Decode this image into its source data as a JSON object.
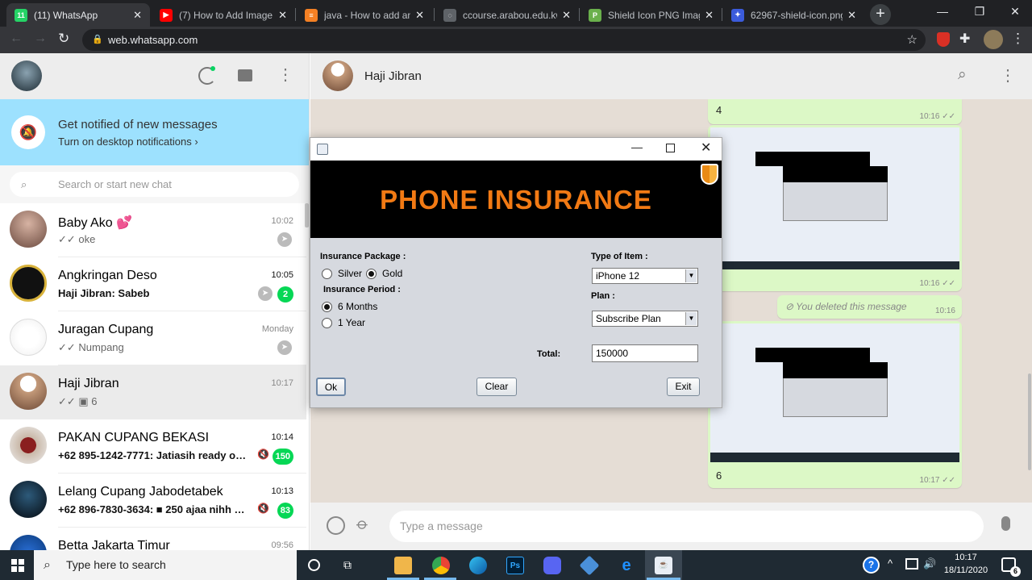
{
  "browser": {
    "tabs": [
      {
        "title": "(11) WhatsApp",
        "fav_color": "#25d366",
        "fav_text": "11"
      },
      {
        "title": "(7) How to Add Image t",
        "fav_color": "#ff0000",
        "fav_text": "▶"
      },
      {
        "title": "java - How to add an im",
        "fav_color": "#f48024",
        "fav_text": "≡"
      },
      {
        "title": "ccourse.arabou.edu.kw",
        "fav_color": "#5f6368",
        "fav_text": "◌"
      },
      {
        "title": "Shield Icon PNG Image",
        "fav_color": "#6ab04c",
        "fav_text": "P"
      },
      {
        "title": "62967-shield-icon.png",
        "fav_color": "#3b5bdb",
        "fav_text": "✦"
      }
    ],
    "url": "web.whatsapp.com"
  },
  "whatsapp": {
    "notification": {
      "title": "Get notified of new messages",
      "subtitle": "Turn on desktop notifications ›"
    },
    "search_placeholder": "Search or start new chat",
    "chats": [
      {
        "name": "Baby Ako 💕",
        "time": "10:02",
        "preview": "✓✓ oke"
      },
      {
        "name": "Angkringan Deso",
        "time": "10:05",
        "preview": "Haji Jibran: Sabeb",
        "badge": "2"
      },
      {
        "name": "Juragan Cupang",
        "time": "Monday",
        "preview": "✓✓ Numpang"
      },
      {
        "name": "Haji Jibran",
        "time": "10:17",
        "preview": "✓✓ ▣ 6"
      },
      {
        "name": "PAKAN CUPANG BEKASI",
        "time": "10:14",
        "preview": "+62 895-1242-7771: Jatiasih ready om...",
        "badge": "150"
      },
      {
        "name": "Lelang Cupang Jabodetabek",
        "time": "10:13",
        "preview": "+62 896-7830-3634: ■ 250 ajaa nihh 1 ...",
        "badge": "83"
      },
      {
        "name": "Betta Jakarta Timur",
        "time": "09:56",
        "preview": ""
      }
    ],
    "contact_name": "Haji Jibran",
    "messages": [
      {
        "text": "4",
        "time": "10:16 ✓✓"
      },
      {
        "text": "",
        "time": "10:16 ✓✓"
      },
      {
        "text": "You deleted this message",
        "time": "10:16"
      },
      {
        "text": "6",
        "time": "10:17 ✓✓"
      }
    ],
    "message_placeholder": "Type a message"
  },
  "dialog": {
    "banner_title": "PHONE INSURANCE",
    "insurance_package_label": "Insurance Package :",
    "package_options": [
      "Silver",
      "Gold"
    ],
    "insurance_period_label": "Insurance Period :",
    "period_options": [
      "6 Months",
      "1 Year"
    ],
    "type_of_item_label": "Type of Item :",
    "type_of_item_value": "iPhone 12",
    "plan_label": "Plan :",
    "plan_value": "Subscribe Plan",
    "total_label": "Total:",
    "total_value": "150000",
    "buttons": {
      "ok": "Ok",
      "clear": "Clear",
      "exit": "Exit"
    }
  },
  "taskbar": {
    "search_placeholder": "Type here to search",
    "time": "10:17",
    "date": "18/11/2020",
    "notification_count": "6"
  }
}
